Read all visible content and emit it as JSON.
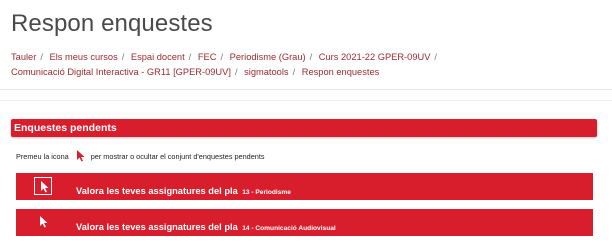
{
  "page": {
    "title": "Respon enquestes"
  },
  "breadcrumb": [
    "Tauler",
    "Els meus cursos",
    "Espai docent",
    "FEC",
    "Periodisme (Grau)",
    "Curs 2021-22 GPER-09UV",
    "Comunicació Digital Interactiva - GR11 [GPER-09UV]",
    "sigmatools",
    "Respon enquestes"
  ],
  "pending": {
    "header": "Enquestes pendents",
    "hint_before": "Premeu la icona",
    "hint_after": "per mostrar o ocultar el conjunt d'enquestes pendents",
    "surveys": [
      {
        "label": "Valora les teves assignatures del pla",
        "detail": "13 - Periodisme"
      },
      {
        "label": "Valora les teves assignatures del pla",
        "detail": "14 - Comunicació Audiovisual"
      }
    ]
  },
  "colors": {
    "accent": "#d81e2c",
    "link": "#9b2b30"
  },
  "icons": {
    "toggle": "cursor-arrow-icon"
  }
}
